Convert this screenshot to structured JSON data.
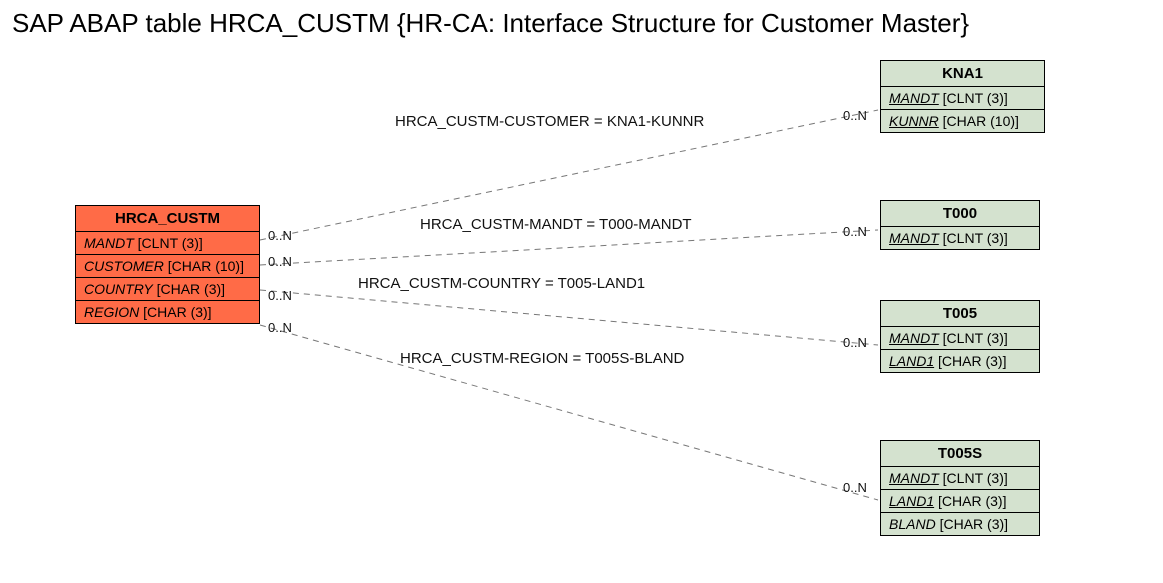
{
  "title": "SAP ABAP table HRCA_CUSTM {HR-CA: Interface Structure for Customer Master}",
  "main": {
    "name": "HRCA_CUSTM",
    "fields": [
      {
        "label": "MANDT",
        "type": "[CLNT (3)]",
        "underline": false
      },
      {
        "label": "CUSTOMER",
        "type": "[CHAR (10)]",
        "underline": false
      },
      {
        "label": "COUNTRY",
        "type": "[CHAR (3)]",
        "underline": false
      },
      {
        "label": "REGION",
        "type": "[CHAR (3)]",
        "underline": false
      }
    ]
  },
  "refs": {
    "kna1": {
      "name": "KNA1",
      "fields": [
        {
          "label": "MANDT",
          "type": "[CLNT (3)]",
          "underline": true
        },
        {
          "label": "KUNNR",
          "type": "[CHAR (10)]",
          "underline": true
        }
      ]
    },
    "t000": {
      "name": "T000",
      "fields": [
        {
          "label": "MANDT",
          "type": "[CLNT (3)]",
          "underline": true
        }
      ]
    },
    "t005": {
      "name": "T005",
      "fields": [
        {
          "label": "MANDT",
          "type": "[CLNT (3)]",
          "underline": true
        },
        {
          "label": "LAND1",
          "type": "[CHAR (3)]",
          "underline": true
        }
      ]
    },
    "t005s": {
      "name": "T005S",
      "fields": [
        {
          "label": "MANDT",
          "type": "[CLNT (3)]",
          "underline": true
        },
        {
          "label": "LAND1",
          "type": "[CHAR (3)]",
          "underline": true
        },
        {
          "label": "BLAND",
          "type": "[CHAR (3)]",
          "underline": false
        }
      ]
    }
  },
  "relations": {
    "r1": {
      "label": "HRCA_CUSTM-CUSTOMER = KNA1-KUNNR",
      "leftCard": "0..N",
      "rightCard": "0..N"
    },
    "r2": {
      "label": "HRCA_CUSTM-MANDT = T000-MANDT",
      "leftCard": "0..N",
      "rightCard": "0..N"
    },
    "r3": {
      "label": "HRCA_CUSTM-COUNTRY = T005-LAND1",
      "leftCard": "0..N",
      "rightCard": "0..N"
    },
    "r4": {
      "label": "HRCA_CUSTM-REGION = T005S-BLAND",
      "leftCard": "0..N",
      "rightCard": "0..N"
    }
  }
}
